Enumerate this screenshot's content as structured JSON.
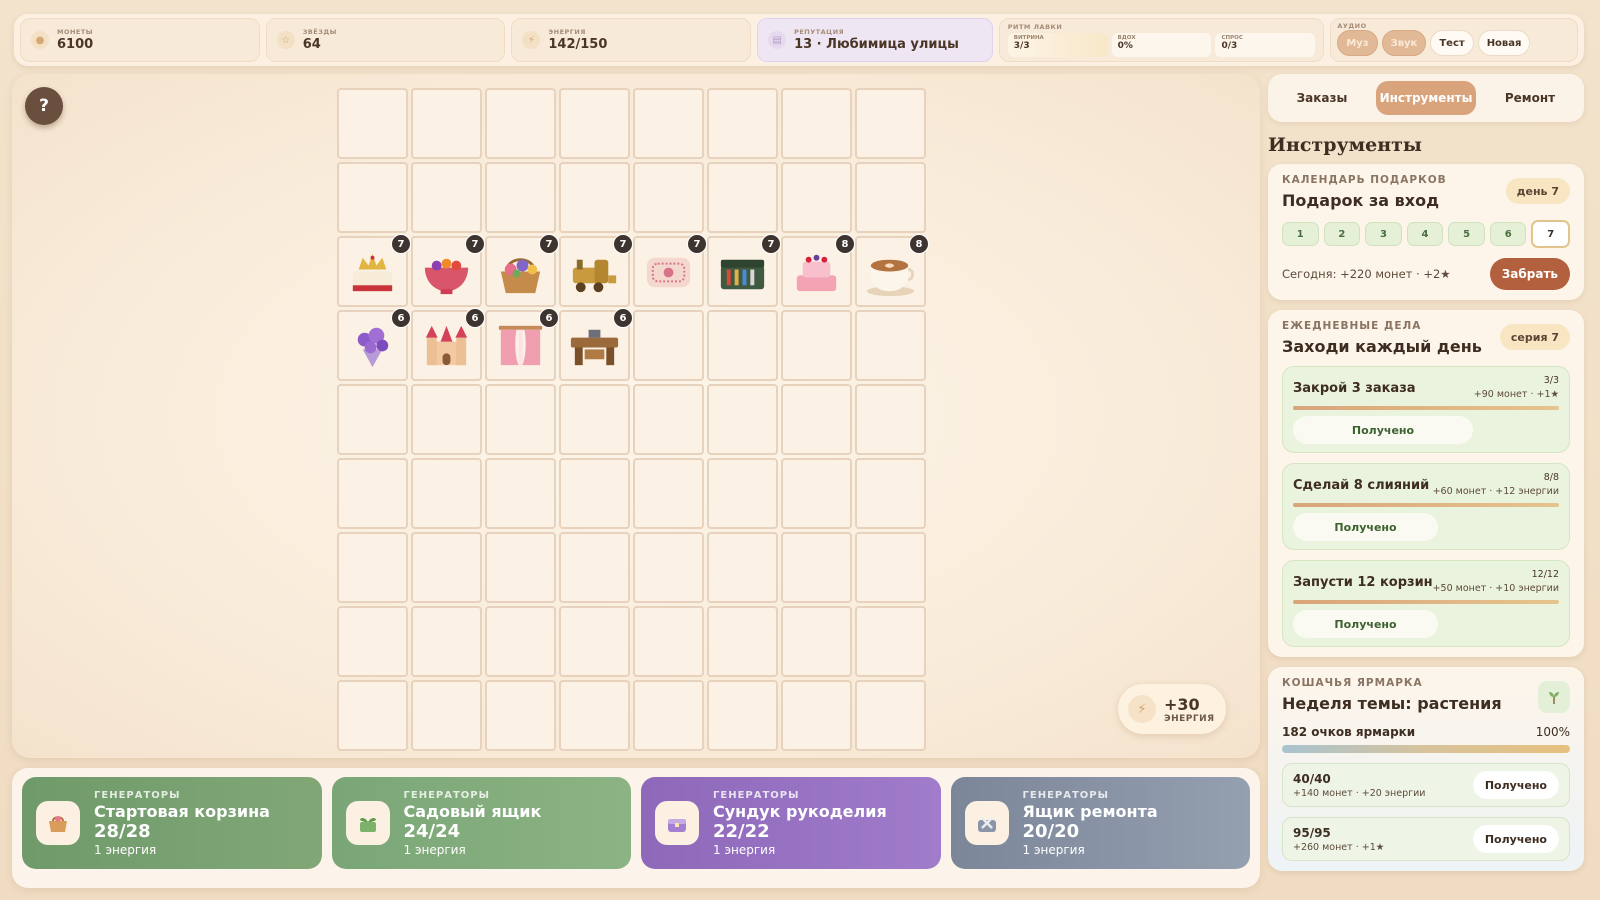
{
  "topbar": {
    "coins": {
      "label": "МОНЕТЫ",
      "value": "6100"
    },
    "stars": {
      "label": "ЗВЁЗДЫ",
      "value": "64"
    },
    "energy": {
      "label": "ЭНЕРГИЯ",
      "value": "142/150"
    },
    "reputation": {
      "label": "РЕПУТАЦИЯ",
      "value": "13 · Любимица улицы"
    },
    "rhythm": {
      "label": "РИТМ ЛАВКИ",
      "cells": [
        {
          "label": "ВИТРИНА",
          "value": "3/3"
        },
        {
          "label": "ВДОХ",
          "value": "0%"
        },
        {
          "label": "СПРОС",
          "value": "0/3"
        }
      ]
    },
    "audio": {
      "label": "АУДИО",
      "buttons": [
        "Муз",
        "Звук",
        "Тест",
        "Новая"
      ]
    }
  },
  "board": {
    "help_label": "?",
    "rows": 9,
    "cols": 8,
    "items": [
      {
        "row": 2,
        "col": 0,
        "name": "cake-crown",
        "level": "7"
      },
      {
        "row": 2,
        "col": 1,
        "name": "fruit-punch-bowl",
        "level": "7"
      },
      {
        "row": 2,
        "col": 2,
        "name": "flower-basket",
        "level": "7"
      },
      {
        "row": 2,
        "col": 3,
        "name": "toy-train",
        "level": "7"
      },
      {
        "row": 2,
        "col": 4,
        "name": "embroidered-pillow",
        "level": "7"
      },
      {
        "row": 2,
        "col": 5,
        "name": "toolbox",
        "level": "7"
      },
      {
        "row": 2,
        "col": 6,
        "name": "berry-cake",
        "level": "8"
      },
      {
        "row": 2,
        "col": 7,
        "name": "latte-cup",
        "level": "8"
      },
      {
        "row": 3,
        "col": 0,
        "name": "lavender-bouquet",
        "level": "6"
      },
      {
        "row": 3,
        "col": 1,
        "name": "fairy-castle",
        "level": "6"
      },
      {
        "row": 3,
        "col": 2,
        "name": "pink-curtains",
        "level": "6"
      },
      {
        "row": 3,
        "col": 3,
        "name": "workbench",
        "level": "6"
      }
    ],
    "energy_bonus": {
      "value": "+30",
      "label": "ЭНЕРГИЯ"
    }
  },
  "generators": [
    {
      "kicker": "ГЕНЕРАТОРЫ",
      "name": "Стартовая корзина",
      "count": "28/28",
      "cost": "1 энергия",
      "icon": "basket-icon"
    },
    {
      "kicker": "ГЕНЕРАТОРЫ",
      "name": "Садовый ящик",
      "count": "24/24",
      "cost": "1 энергия",
      "icon": "garden-box-icon"
    },
    {
      "kicker": "ГЕНЕРАТОРЫ",
      "name": "Сундук рукоделия",
      "count": "22/22",
      "cost": "1 энергия",
      "icon": "craft-chest-icon"
    },
    {
      "kicker": "ГЕНЕРАТОРЫ",
      "name": "Ящик ремонта",
      "count": "20/20",
      "cost": "1 энергия",
      "icon": "repair-box-icon"
    }
  ],
  "side": {
    "tabs": [
      "Заказы",
      "Инструменты",
      "Ремонт"
    ],
    "active_tab": "Инструменты",
    "title": "Инструменты",
    "calendar": {
      "kicker": "КАЛЕНДАРЬ ПОДАРКОВ",
      "title": "Подарок за вход",
      "pill": "день 7",
      "days": [
        "1",
        "2",
        "3",
        "4",
        "5",
        "6",
        "7"
      ],
      "today": "Сегодня: +220 монет · +2★",
      "claim": "Забрать"
    },
    "daily": {
      "kicker": "ЕЖЕДНЕВНЫЕ ДЕЛА",
      "title": "Заходи каждый день",
      "pill": "серия 7",
      "tasks": [
        {
          "name": "Закрой 3 заказа",
          "progress": "3/3",
          "reward": "+90 монет · +1★",
          "status": "Получено"
        },
        {
          "name": "Сделай 8 слияний",
          "progress": "8/8",
          "reward": "+60 монет · +12 энергии",
          "status": "Получено"
        },
        {
          "name": "Запусти 12 корзин",
          "progress": "12/12",
          "reward": "+50 монет · +10 энергии",
          "status": "Получено"
        }
      ]
    },
    "fair": {
      "kicker": "КОШАЧЬЯ ЯРМАРКА",
      "title": "Неделя темы: растения",
      "points": "182 очков ярмарки",
      "percent": "100%",
      "fill": 1.0,
      "milestones": [
        {
          "value": "40/40",
          "reward": "+140 монет · +20 энергии",
          "status": "Получено"
        },
        {
          "value": "95/95",
          "reward": "+260 монет · +1★",
          "status": "Получено"
        }
      ]
    }
  },
  "colors": {
    "accent": "#d9a47c",
    "claim": "#b2603d",
    "badge": "#3d3430"
  }
}
